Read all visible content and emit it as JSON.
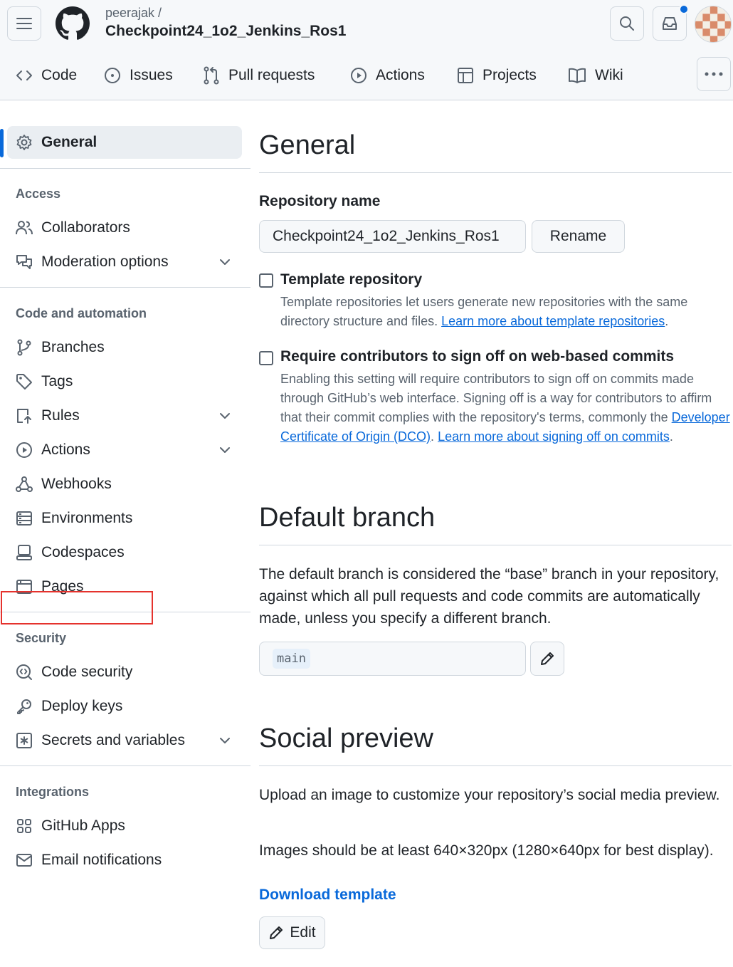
{
  "header": {
    "owner": "peerajak /",
    "repo_name": "Checkpoint24_1o2_Jenkins_Ros1"
  },
  "repo_tabs": [
    {
      "label": "Code",
      "icon": "code-icon"
    },
    {
      "label": "Issues",
      "icon": "issue-icon"
    },
    {
      "label": "Pull requests",
      "icon": "pull-request-icon"
    },
    {
      "label": "Actions",
      "icon": "play-icon"
    },
    {
      "label": "Projects",
      "icon": "table-icon"
    },
    {
      "label": "Wiki",
      "icon": "book-icon"
    }
  ],
  "sidebar": {
    "general": "General",
    "access_heading": "Access",
    "collaborators": "Collaborators",
    "moderation_options": "Moderation options",
    "code_automation_heading": "Code and automation",
    "branches": "Branches",
    "tags": "Tags",
    "rules": "Rules",
    "actions": "Actions",
    "webhooks": "Webhooks",
    "environments": "Environments",
    "codespaces": "Codespaces",
    "pages": "Pages",
    "security_heading": "Security",
    "code_security": "Code security",
    "deploy_keys": "Deploy keys",
    "secrets_variables": "Secrets and variables",
    "integrations_heading": "Integrations",
    "github_apps": "GitHub Apps",
    "email_notifications": "Email notifications"
  },
  "main": {
    "general_title": "General",
    "repo_name_label": "Repository name",
    "repo_name_value": "Checkpoint24_1o2_Jenkins_Ros1",
    "rename_button": "Rename",
    "template_title": "Template repository",
    "template_desc": "Template repositories let users generate new repositories with the same directory structure and files.",
    "template_link": "Learn more about template repositories",
    "signoff_title": "Require contributors to sign off on web-based commits",
    "signoff_desc_1": "Enabling this setting will require contributors to sign off on commits made through GitHub’s web interface. Signing off is a way for contributors to affirm that their commit complies with the repository's terms, commonly the",
    "signoff_link_dco": "Developer Certificate of Origin (DCO)",
    "signoff_link_learn": "Learn more about signing off on commits",
    "default_branch_title": "Default branch",
    "default_branch_desc": "The default branch is considered the “base” branch in your repository, against which all pull requests and code commits are automatically made, unless you specify a different branch.",
    "default_branch_value": "main",
    "social_preview_title": "Social preview",
    "social_desc_1": "Upload an image to customize your repository’s social media preview.",
    "social_desc_2": "Images should be at least 640×320px (1280×640px for best display).",
    "download_template": "Download template",
    "edit_button": "Edit"
  }
}
